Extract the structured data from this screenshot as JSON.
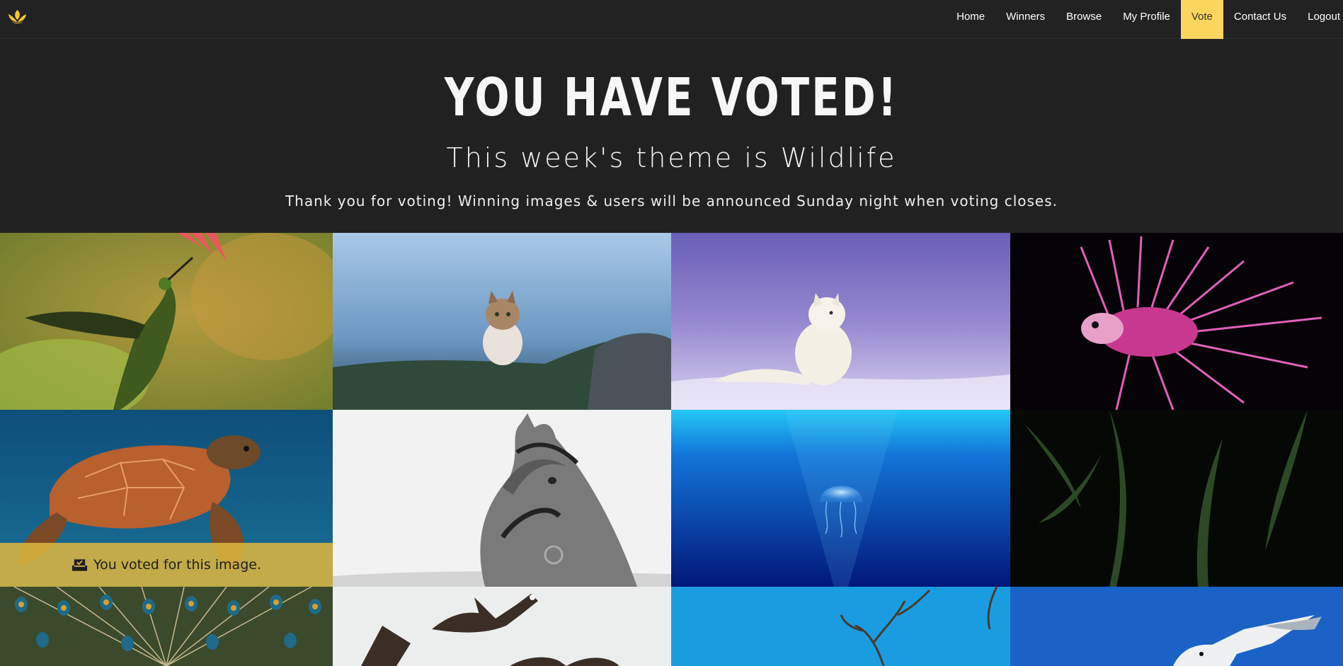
{
  "nav": {
    "logo_icon": "lotus-logo-icon",
    "items": [
      {
        "label": "Home",
        "active": false
      },
      {
        "label": "Winners",
        "active": false
      },
      {
        "label": "Browse",
        "active": false
      },
      {
        "label": "My Profile",
        "active": false
      },
      {
        "label": "Vote",
        "active": true
      },
      {
        "label": "Contact Us",
        "active": false
      },
      {
        "label": "Logout",
        "active": false
      }
    ]
  },
  "hero": {
    "title": "YOU HAVE VOTED!",
    "subtitle": "This week's theme is Wildlife",
    "message": "Thank you for voting! Winning images & users will be announced Sunday night when voting closes."
  },
  "gallery": {
    "voted_label": "You voted for this image.",
    "voted_icon": "inbox-check-icon",
    "images": [
      {
        "subject": "hummingbird"
      },
      {
        "subject": "cat"
      },
      {
        "subject": "arctic-fox"
      },
      {
        "subject": "lionfish"
      },
      {
        "subject": "sea-turtle",
        "voted": true
      },
      {
        "subject": "horse"
      },
      {
        "subject": "jellyfish"
      },
      {
        "subject": "palm-leaves"
      },
      {
        "subject": "peacock"
      },
      {
        "subject": "geese"
      },
      {
        "subject": "tree-branches"
      },
      {
        "subject": "seagull"
      }
    ]
  },
  "colors": {
    "background": "#212121",
    "accent": "#fdd55e",
    "voted_banner": "#dab43e"
  }
}
